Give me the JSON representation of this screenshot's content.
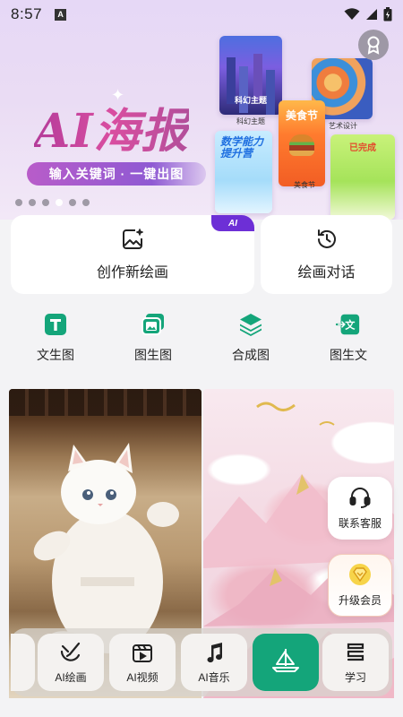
{
  "status_bar": {
    "time": "8:57",
    "notification_letter": "A"
  },
  "banner": {
    "title": "AI海报",
    "subtitle": "输入关键词 · 一键出图",
    "posters": [
      {
        "label": "科幻主题",
        "caption": "科幻主题"
      },
      {
        "caption": "艺术设计"
      },
      {
        "title": "数学能力提升营"
      },
      {
        "title": "美食节",
        "caption": "美食节"
      },
      {
        "title": "已完成"
      }
    ],
    "carousel_dots": 6,
    "active_dot": 4
  },
  "actions": {
    "create": {
      "label": "创作新绘画",
      "badge": "AI"
    },
    "chat": {
      "label": "绘画对话"
    }
  },
  "tools": [
    {
      "label": "文生图",
      "icon": "text-t-icon"
    },
    {
      "label": "图生图",
      "icon": "images-icon"
    },
    {
      "label": "合成图",
      "icon": "layers-icon"
    },
    {
      "label": "图生文",
      "icon": "image-to-text-icon"
    }
  ],
  "gallery": [
    {
      "subject": "white-kitten-karate"
    },
    {
      "subject": "pink-mountains-clouds"
    }
  ],
  "floating": {
    "service": {
      "label": "联系客服",
      "icon": "headset-icon"
    },
    "vip": {
      "label": "升级会员",
      "icon": "diamond-icon"
    }
  },
  "dock": [
    {
      "label": "AI绘画",
      "icon": "paint-icon"
    },
    {
      "label": "AI视频",
      "icon": "video-icon"
    },
    {
      "label": "AI音乐",
      "icon": "music-icon"
    },
    {
      "label": "",
      "icon": "home-sail-icon",
      "active": true
    },
    {
      "label": "学习",
      "icon": "study-icon"
    }
  ],
  "colors": {
    "accent": "#14a57a",
    "purple": "#6d2fd6",
    "title_pink": "#c9489f"
  }
}
